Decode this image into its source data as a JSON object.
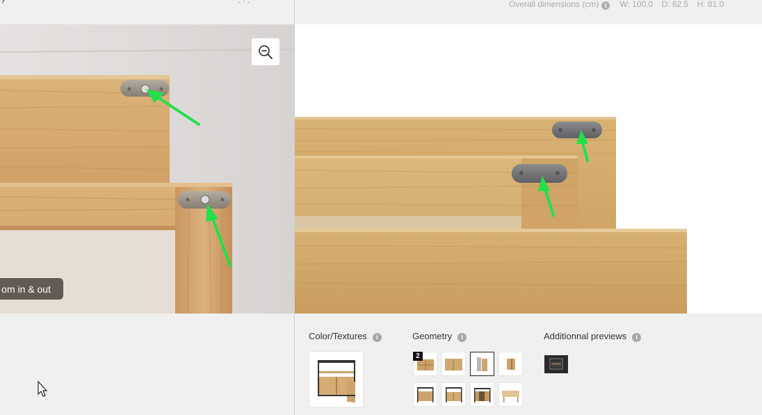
{
  "top_left_fragment": "y",
  "top_right_fragment": "¸ ,  ¸",
  "dimensions": {
    "label": "Overall dimensions (cm)",
    "info": "i",
    "w": "W: 100.0",
    "d": "D: 62.5",
    "h": "H: 81.0"
  },
  "zoom_hint": "om in & out",
  "sections": {
    "color": {
      "label": "Color/Textures",
      "info": "i"
    },
    "geometry": {
      "label": "Geometry",
      "info": "i",
      "badge": "2"
    },
    "additional": {
      "label": "Additionnal previews",
      "info": "i"
    }
  },
  "colors": {
    "wood_light": "#d9b27a",
    "wood_mid": "#c8995e",
    "wood_dark": "#a97c45",
    "bracket": "#7c7c80",
    "arrow": "#22e04a",
    "zoom_pill": "#3c342e"
  },
  "icons": {
    "zoom": "zoom-out-icon",
    "info": "info-icon",
    "cursor": "mouse-pointer-icon"
  }
}
